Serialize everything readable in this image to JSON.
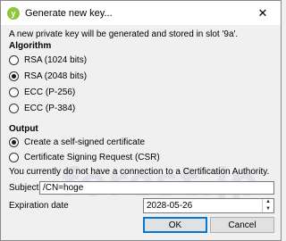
{
  "window": {
    "title": "Generate new key...",
    "icon": "yubikey-logo-icon",
    "close_glyph": "✕"
  },
  "intro_text": "A new private key will be generated and stored in slot '9a'.",
  "algorithm": {
    "heading": "Algorithm",
    "options": [
      {
        "label": "RSA (1024 bits)",
        "checked": false
      },
      {
        "label": "RSA (2048 bits)",
        "checked": true
      },
      {
        "label": "ECC (P-256)",
        "checked": false
      },
      {
        "label": "ECC (P-384)",
        "checked": false
      }
    ]
  },
  "output": {
    "heading": "Output",
    "options": [
      {
        "label": "Create a self-signed certificate",
        "checked": true
      },
      {
        "label": "Certificate Signing Request (CSR)",
        "checked": false
      }
    ],
    "ca_notice": "You currently do not have a connection to a Certification Authority."
  },
  "subject": {
    "label": "Subject",
    "value": "/CN=hoge"
  },
  "expiration": {
    "label": "Expiration date",
    "value": "2028-05-26"
  },
  "buttons": {
    "ok": "OK",
    "cancel": "Cancel"
  },
  "watermark": "forest.jp"
}
